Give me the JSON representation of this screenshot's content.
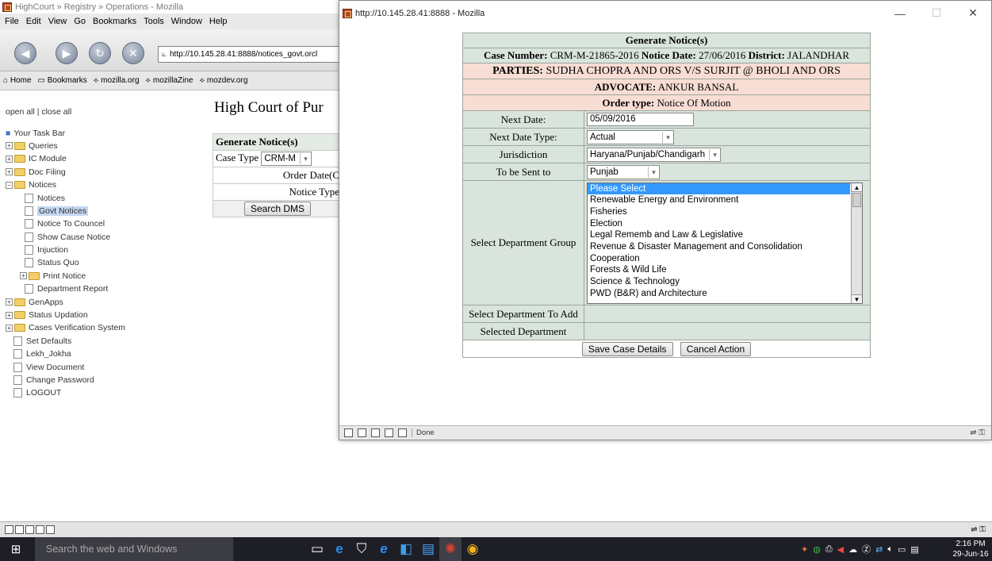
{
  "back_window": {
    "title": "HighCourt » Registry » Operations - Mozilla",
    "menu": [
      "File",
      "Edit",
      "View",
      "Go",
      "Bookmarks",
      "Tools",
      "Window",
      "Help"
    ],
    "url": "http://10.145.28.41:8888/notices_govt.orcl",
    "bookmarks": [
      "Home",
      "Bookmarks",
      "mozilla.org",
      "mozillaZine",
      "mozdev.org"
    ],
    "tree_header": "open all | close all",
    "tree": [
      {
        "label": "Your Task Bar",
        "kind": "root"
      },
      {
        "label": "Queries",
        "kind": "folder"
      },
      {
        "label": "IC Module",
        "kind": "folder"
      },
      {
        "label": "Doc Filing",
        "kind": "folder"
      },
      {
        "label": "Notices",
        "kind": "folder-open"
      },
      {
        "label": "Notices",
        "kind": "doc"
      },
      {
        "label": "Govt Notices",
        "kind": "doc-selected"
      },
      {
        "label": "Notice To Councel",
        "kind": "doc"
      },
      {
        "label": "Show Cause Notice",
        "kind": "doc"
      },
      {
        "label": "Injuction",
        "kind": "doc"
      },
      {
        "label": "Status Quo",
        "kind": "doc"
      },
      {
        "label": "Print Notice",
        "kind": "subfolder"
      },
      {
        "label": "Department Report",
        "kind": "doc"
      },
      {
        "label": "GenApps",
        "kind": "folder"
      },
      {
        "label": "Status Updation",
        "kind": "folder"
      },
      {
        "label": "Cases Verification System",
        "kind": "folder"
      },
      {
        "label": "Set Defaults",
        "kind": "rootdoc"
      },
      {
        "label": "Lekh_Jokha",
        "kind": "rootdoc"
      },
      {
        "label": "View Document",
        "kind": "rootdoc"
      },
      {
        "label": "Change Password",
        "kind": "rootdoc"
      },
      {
        "label": "LOGOUT",
        "kind": "rootdoc"
      }
    ],
    "page_heading": "High Court of Pur",
    "form": {
      "title": "Generate Notice(s)",
      "case_type_label": "Case Type",
      "case_type_value": "CRM-M",
      "order_date_label": "Order Date(C",
      "notice_type_label": "Notice Type",
      "search_button": "Search DMS"
    }
  },
  "front_window": {
    "title": "http://10.145.28.41:8888 - Mozilla",
    "status": "Done",
    "notice": {
      "title": "Generate Notice(s)",
      "case_number_label": "Case Number:",
      "case_number": "CRM-M-21865-2016",
      "notice_date_label": "Notice Date:",
      "notice_date": "27/06/2016",
      "district_label": "District:",
      "district": "JALANDHAR",
      "parties_label": "PARTIES:",
      "parties": "SUDHA CHOPRA AND ORS V/S SURJIT @ BHOLI AND ORS",
      "advocate_label": "ADVOCATE:",
      "advocate": "ANKUR BANSAL",
      "order_type_label": "Order type:",
      "order_type": "Notice Of Motion",
      "next_date_label": "Next Date:",
      "next_date": "05/09/2016",
      "next_date_type_label": "Next Date Type:",
      "next_date_type": "Actual",
      "jurisdiction_label": "Jurisdiction",
      "jurisdiction": "Haryana/Punjab/Chandigarh",
      "sent_to_label": "To be Sent to",
      "sent_to": "Punjab",
      "dept_group_label": "Select Department Group",
      "dept_groups": [
        "Please Select",
        "Renewable Energy and Environment",
        "Fisheries",
        "Election",
        "Legal Rememb and Law & Legislative",
        "Revenue & Disaster Management and Consolidation",
        "Cooperation",
        "Forests & Wild Life",
        "Science & Technology",
        "PWD (B&R) and Architecture"
      ],
      "dept_add_label": "Select Department To Add",
      "selected_dept_label": "Selected Department",
      "save_button": "Save Case Details",
      "cancel_button": "Cancel Action"
    }
  },
  "taskbar": {
    "search_placeholder": "Search the web and Windows",
    "time": "2:16 PM",
    "date": "29-Jun-16"
  }
}
